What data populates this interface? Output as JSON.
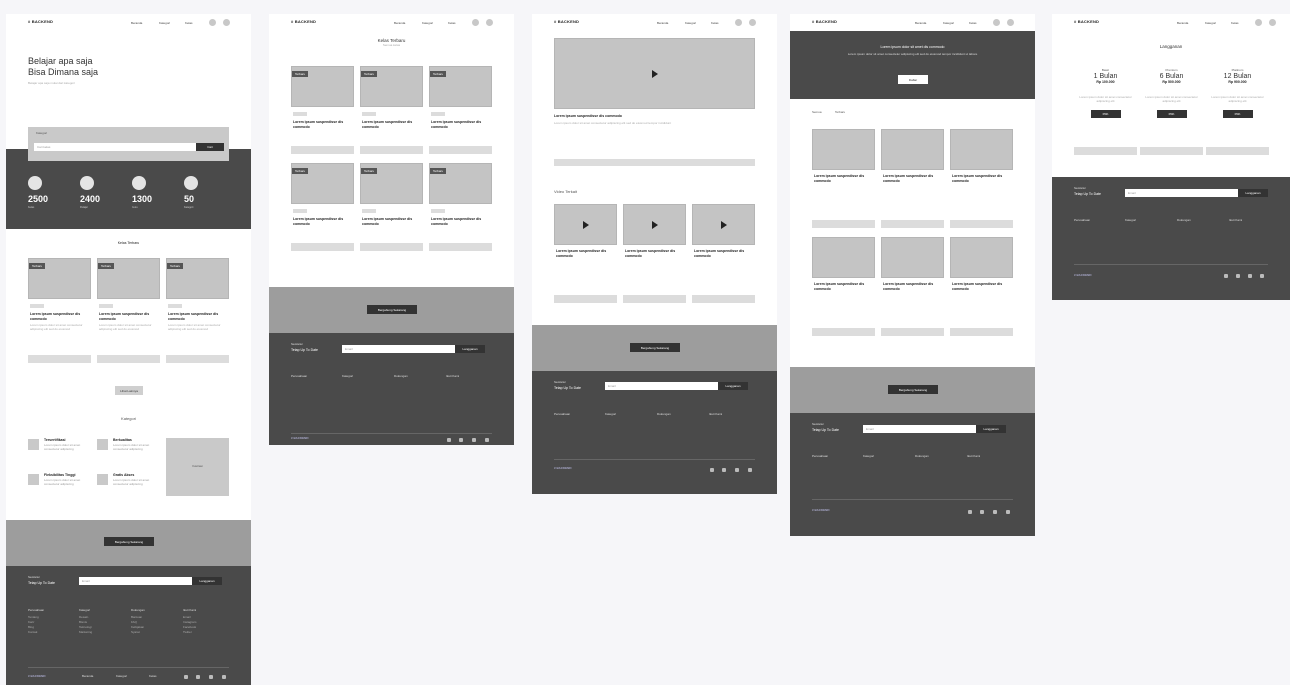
{
  "nav": {
    "logo": "# BACKEND",
    "links": [
      "Beranda",
      "Kategori",
      "Kelas"
    ]
  },
  "hero": {
    "title_line1": "Belajar apa saja",
    "title_line2": "Bisa Dimana saja",
    "subtitle": "Belajar apa saja mulai dari kategori",
    "search_label": "Kategori",
    "search_placeholder": "Cari kelas",
    "search_button": "Cari"
  },
  "stats": [
    {
      "num": "2500",
      "label": "Kelas"
    },
    {
      "num": "2400",
      "label": "Pelajar"
    },
    {
      "num": "1300",
      "label": "Guru"
    },
    {
      "num": "50",
      "label": "Kategori"
    }
  ],
  "course_section_title": "Kelas Terbaru",
  "course": {
    "tag": "Kategori",
    "badge": "Terbaru",
    "title": "Lorem ipsum suspendisse dis commodo",
    "desc": "Lorem ipsum dolor sit amet consectetur adipiscing elit sed do eiusmod",
    "meta": "12 Jam"
  },
  "more_button": "Lihat Lainnya",
  "why": {
    "title": "Kategori",
    "items": [
      {
        "title": "Tersertifikasi",
        "desc": "Lorem ipsum dolor sit amet consectetur adipiscing"
      },
      {
        "title": "Berkualitas",
        "desc": "Lorem ipsum dolor sit amet consectetur adipiscing"
      },
      {
        "title": "Fleksibilitas Tinggi",
        "desc": "Lorem ipsum dolor sit amet consectetur adipiscing"
      },
      {
        "title": "Gratis Akses",
        "desc": "Lorem ipsum dolor sit amet consectetur adipiscing"
      }
    ],
    "image_label": "Ilustrasi"
  },
  "cta_button": "Bergabung Sekarang",
  "footer": {
    "label": "Newsletter",
    "tagline": "Tetap Up To Date",
    "input_placeholder": "Email",
    "subscribe": "Langganan",
    "cols": [
      {
        "head": "Perusahaan",
        "items": [
          "Tentang",
          "Karir",
          "Blog",
          "Kontak"
        ]
      },
      {
        "head": "Kategori",
        "items": [
          "Desain",
          "Bisnis",
          "Teknologi",
          "Marketing"
        ]
      },
      {
        "head": "Dukungan",
        "items": [
          "Bantuan",
          "FAQ",
          "Kebijakan",
          "Syarat"
        ]
      },
      {
        "head": "Ikuti Kami",
        "items": [
          "Email",
          "Instagram",
          "Facebook",
          "Twitter"
        ]
      }
    ],
    "bottom_logo": "# BACKEND",
    "bottom_links": [
      "Beranda",
      "Kategori",
      "Kelas"
    ]
  },
  "catalog": {
    "title": "Kelas Terbaru",
    "subtitle": "Semua kelas"
  },
  "detail": {
    "video_title": "Lorem ipsum suspendisse dis commodo",
    "video_desc": "Lorem ipsum dolor sit amet consectetur adipiscing elit sed do eiusmod tempor incididunt",
    "section": "Video Terkait"
  },
  "category_page": {
    "hero_title": "Lorem ipsum dolor sit amet dis commodo",
    "hero_desc": "Lorem ipsum dolor sit amet consectetur adipiscing elit sed do eiusmod tempor incididunt ut labore",
    "hero_button": "Daftar",
    "tabs": [
      "Semua",
      "Terbaru"
    ]
  },
  "pricing": {
    "title": "Langganan",
    "plans": [
      {
        "tag": "Basic",
        "name": "1 Bulan",
        "price": "Rp 100.000",
        "button": "Pilih"
      },
      {
        "tag": "Premium",
        "name": "6 Bulan",
        "price": "Rp 500.000",
        "button": "Pilih"
      },
      {
        "tag": "Platinum",
        "name": "12 Bulan",
        "price": "Rp 900.000",
        "button": "Pilih"
      }
    ],
    "desc": "Lorem ipsum dolor sit amet consectetur adipiscing elit"
  },
  "colors": {
    "dark": "#4a4a4a",
    "mid": "#9d9d9d",
    "placeholder": "#c4c4c4",
    "background": "#f6f6f9"
  }
}
